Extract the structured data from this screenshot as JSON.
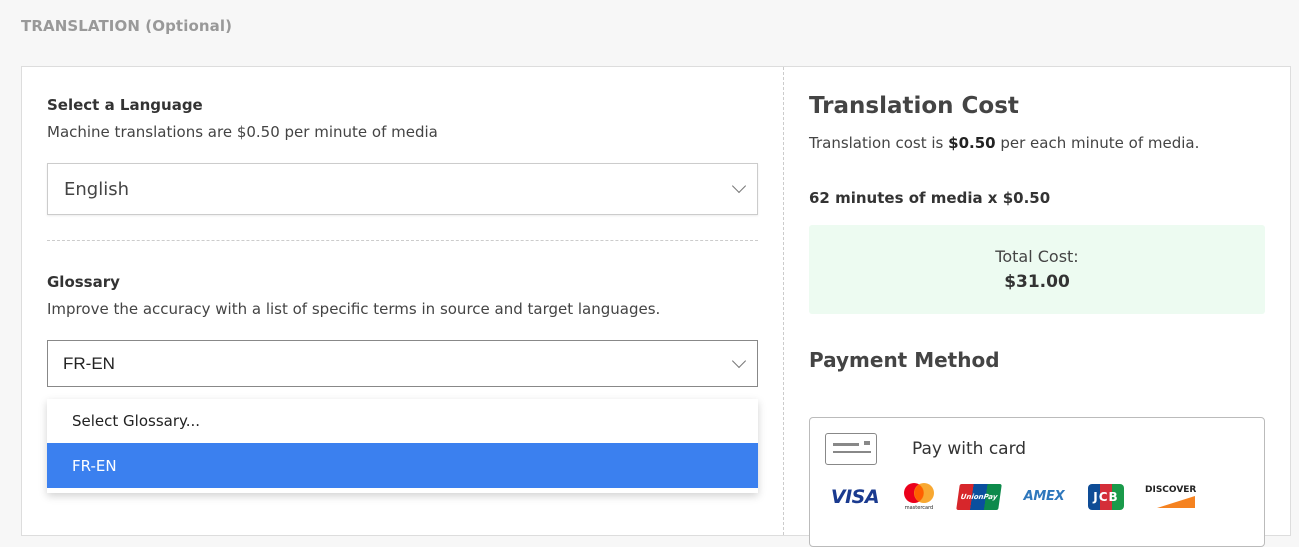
{
  "section": {
    "title": "TRANSLATION (Optional)"
  },
  "language": {
    "label": "Select a Language",
    "description": "Machine translations are $0.50 per minute of media",
    "selected": "English"
  },
  "glossary": {
    "label": "Glossary",
    "description": "Improve the accuracy with a list of specific terms in source and target languages.",
    "selected": "FR-EN",
    "options": [
      "Select Glossary...",
      "FR-EN"
    ]
  },
  "cost": {
    "title": "Translation Cost",
    "desc_prefix": "Translation cost is ",
    "desc_rate": "$0.50",
    "desc_suffix": " per each minute of media.",
    "calculation": "62 minutes of media x $0.50",
    "total_label": "Total Cost:",
    "total_value": "$31.00"
  },
  "payment": {
    "title": "Payment Method",
    "card_label": "Pay with card",
    "brands": {
      "visa": "VISA",
      "mastercard": "mastercard",
      "unionpay": "UnionPay",
      "amex": "AMEX",
      "jcb": "JCB",
      "discover": "DISCOVER"
    }
  },
  "colors": {
    "accent": "#3b80ef",
    "total_bg": "#edfbf1"
  }
}
